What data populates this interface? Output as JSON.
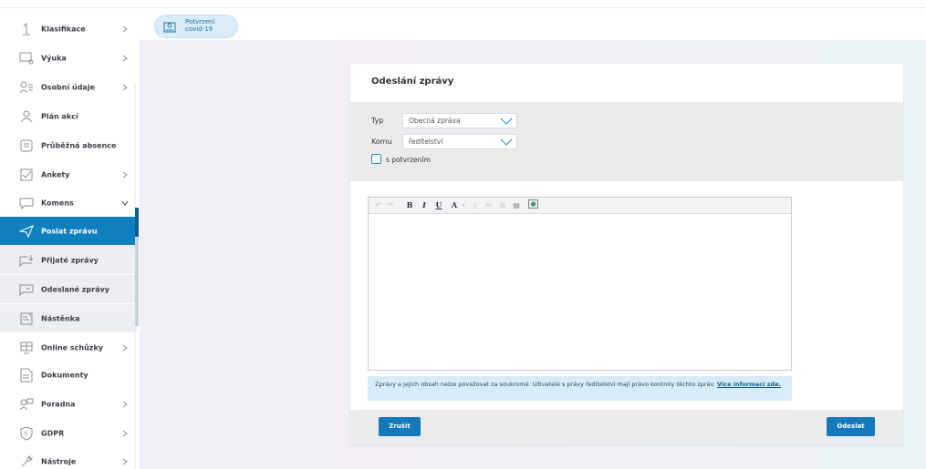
{
  "sidebar": {
    "items": [
      {
        "label": "Klasifikace",
        "icon": "number-one-icon",
        "chevron": "right"
      },
      {
        "label": "Výuka",
        "icon": "classroom-icon",
        "chevron": "right"
      },
      {
        "label": "Osobní údaje",
        "icon": "personal-data-icon",
        "chevron": "right"
      },
      {
        "label": "Plán akcí",
        "icon": "people-icon",
        "chevron": ""
      },
      {
        "label": "Průběžná absence",
        "icon": "absence-icon",
        "chevron": ""
      },
      {
        "label": "Ankety",
        "icon": "checkbox-icon",
        "chevron": "right"
      },
      {
        "label": "Komens",
        "icon": "chat-icon",
        "chevron": "down"
      },
      {
        "label": "Poslat zprávu",
        "icon": "send-icon",
        "chevron": ""
      },
      {
        "label": "Přijaté zprávy",
        "icon": "inbox-icon",
        "chevron": ""
      },
      {
        "label": "Odeslané zprávy",
        "icon": "outbox-icon",
        "chevron": ""
      },
      {
        "label": "Nástěnka",
        "icon": "noticeboard-icon",
        "chevron": ""
      },
      {
        "label": "Online schůzky",
        "icon": "meeting-icon",
        "chevron": "right"
      },
      {
        "label": "Dokumenty",
        "icon": "document-icon",
        "chevron": ""
      },
      {
        "label": "Poradna",
        "icon": "counseling-icon",
        "chevron": "right"
      },
      {
        "label": "GDPR",
        "icon": "gdpr-icon",
        "chevron": "right"
      },
      {
        "label": "Nástroje",
        "icon": "wrench-icon",
        "chevron": "right"
      }
    ]
  },
  "header": {
    "covid_line1": "Potvrzení",
    "covid_line2": "covid-19"
  },
  "dialog": {
    "title": "Odeslání zprávy",
    "type_label": "Typ",
    "type_value": "Obecná zpráva",
    "to_label": "Komu",
    "to_value": "ředitelství",
    "confirm_label": "s potvrzením",
    "notice_text": "Zprávy a jejich obsah nelze považovat za soukromé. Uživatelé s právy ředitelství mají právo kontroly těchto zpráv.",
    "notice_link": "Více informací zde.",
    "cancel_label": "Zrušit",
    "send_label": "Odeslat"
  },
  "toolbar": {
    "bold": "B",
    "italic": "I",
    "underline": "U",
    "font_color": "A"
  },
  "colors": {
    "accent": "#0f7fbd",
    "button": "#1379bb",
    "form_bg": "#e9ebed",
    "notice_bg": "#d7ebf8"
  }
}
